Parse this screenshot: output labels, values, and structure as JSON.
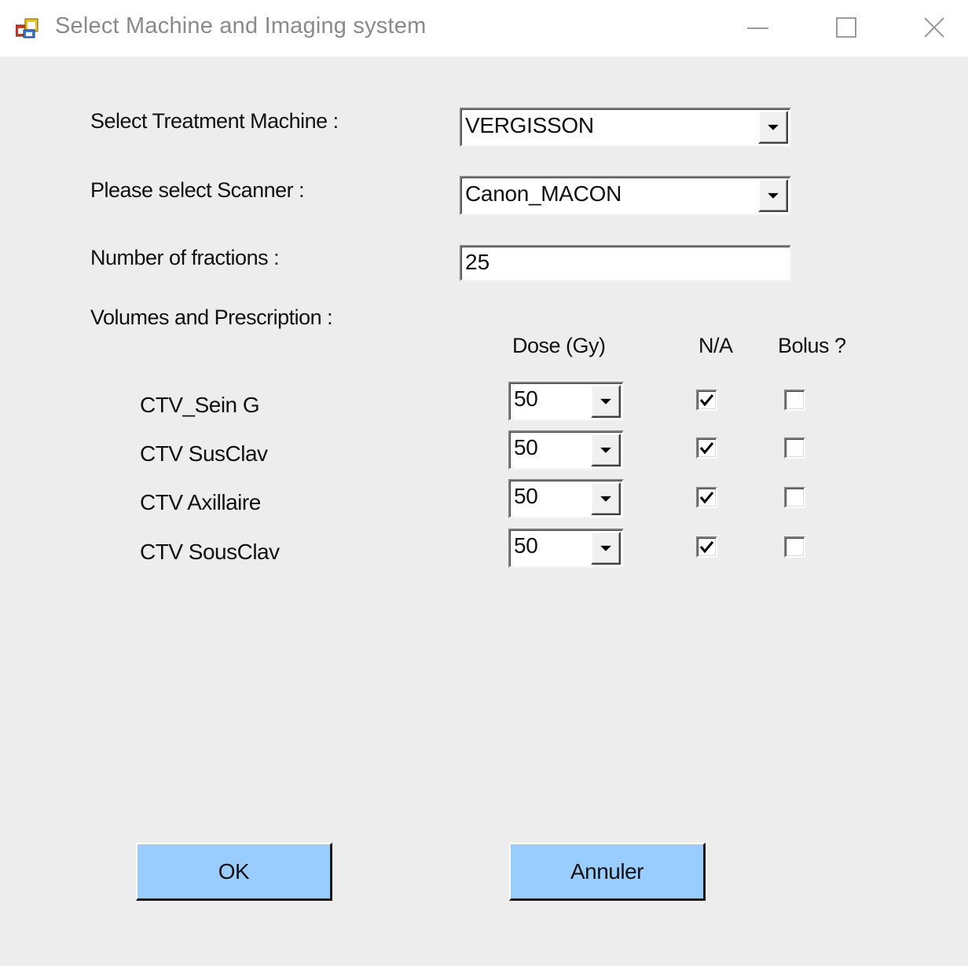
{
  "window": {
    "title": "Select Machine and Imaging system",
    "icon": "windows-form-icon"
  },
  "form": {
    "machine_label": "Select Treatment Machine :",
    "machine_value": "VERGISSON",
    "scanner_label": "Please select Scanner :",
    "scanner_value": "Canon_MACON",
    "fractions_label": "Number of fractions :",
    "fractions_value": "25",
    "volumes_label": "Volumes and Prescription :"
  },
  "table": {
    "headers": {
      "dose": "Dose (Gy)",
      "na": "N/A",
      "bolus": "Bolus ?"
    },
    "rows": [
      {
        "name": "CTV_Sein G",
        "dose": "50",
        "na_checked": true,
        "bolus_checked": false
      },
      {
        "name": "CTV SusClav",
        "dose": "50",
        "na_checked": true,
        "bolus_checked": false
      },
      {
        "name": "CTV Axillaire",
        "dose": "50",
        "na_checked": true,
        "bolus_checked": false
      },
      {
        "name": "CTV SousClav",
        "dose": "50",
        "na_checked": true,
        "bolus_checked": false
      }
    ]
  },
  "buttons": {
    "ok": "OK",
    "cancel": "Annuler"
  },
  "colors": {
    "button_bg": "#99ccff",
    "window_bg": "#ededed"
  }
}
